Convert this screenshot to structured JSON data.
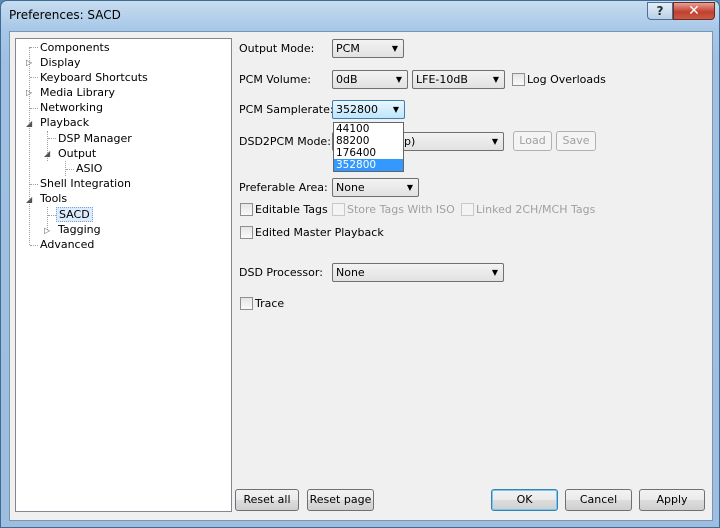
{
  "window": {
    "title": "Preferences: SACD",
    "help_glyph": "?",
    "close_glyph": "✕"
  },
  "tree": {
    "items": [
      {
        "label": "Components"
      },
      {
        "label": "Display"
      },
      {
        "label": "Keyboard Shortcuts"
      },
      {
        "label": "Media Library"
      },
      {
        "label": "Networking"
      },
      {
        "label": "Playback"
      },
      {
        "label": "DSP Manager"
      },
      {
        "label": "Output"
      },
      {
        "label": "ASIO"
      },
      {
        "label": "Shell Integration"
      },
      {
        "label": "Tools"
      },
      {
        "label": "SACD"
      },
      {
        "label": "Tagging"
      },
      {
        "label": "Advanced"
      }
    ]
  },
  "form": {
    "output_mode_label": "Output Mode:",
    "output_mode_value": "PCM",
    "pcm_volume_label": "PCM Volume:",
    "pcm_volume_value": "0dB",
    "lfe_value": "LFE-10dB",
    "log_overloads_label": "Log Overloads",
    "pcm_samplerate_label": "PCM Samplerate:",
    "pcm_samplerate_value": "352800",
    "samplerate_options": [
      "44100",
      "88200",
      "176400",
      "352800"
    ],
    "dsd2pcm_label": "DSD2PCM Mode:",
    "dsd2pcm_value_partial": "p)",
    "load_label": "Load",
    "save_label": "Save",
    "preferable_area_label": "Preferable Area:",
    "preferable_area_value": "None",
    "editable_tags_label": "Editable Tags",
    "store_tags_label": "Store Tags With ISO",
    "linked_label": "Linked 2CH/MCH Tags",
    "edited_master_label": "Edited Master Playback",
    "dsd_processor_label": "DSD Processor:",
    "dsd_processor_value": "None",
    "trace_label": "Trace"
  },
  "footer": {
    "reset_all": "Reset all",
    "reset_page": "Reset page",
    "ok": "OK",
    "cancel": "Cancel",
    "apply": "Apply"
  },
  "glyphs": {
    "collapsed": "▷",
    "expanded": "◢",
    "dropdown": "▼"
  }
}
